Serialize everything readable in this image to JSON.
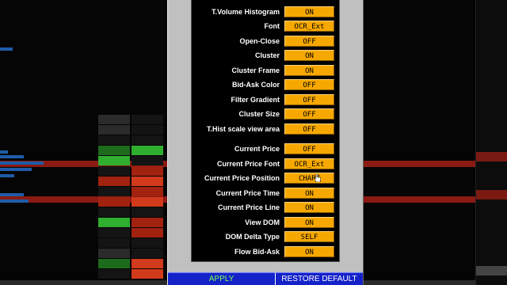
{
  "settings": [
    {
      "label": "T.Volume Histogram",
      "value": "ON"
    },
    {
      "label": "Font",
      "value": "OCR_Ext"
    },
    {
      "label": "Open-Close",
      "value": "OFF"
    },
    {
      "label": "Cluster",
      "value": "ON"
    },
    {
      "label": "Cluster Frame",
      "value": "ON"
    },
    {
      "label": "Bid-Ask Color",
      "value": "OFF"
    },
    {
      "label": "Filter Gradient",
      "value": "OFF"
    },
    {
      "label": "Cluster Size",
      "value": "OFF"
    },
    {
      "label": "T.Hist scale view area",
      "value": "OFF"
    },
    {
      "label": "Current Price",
      "value": "OFF"
    },
    {
      "label": "Current Price Font",
      "value": "OCR_Ext"
    },
    {
      "label": "Current Price Position",
      "value": "CHART"
    },
    {
      "label": "Current Price Time",
      "value": "ON"
    },
    {
      "label": "Current Price Line",
      "value": "ON"
    },
    {
      "label": "View DOM",
      "value": "ON"
    },
    {
      "label": "DOM Delta Type",
      "value": "SELF"
    },
    {
      "label": "Flow Bid-Ask",
      "value": "ON"
    }
  ],
  "footer": {
    "apply_label": "APPLY",
    "restore_label": "RESTORE DEFAULT"
  },
  "colors": {
    "button_bg": "#f6a800",
    "footer_bg": "#1422c8",
    "apply_text": "#7cff4a"
  }
}
